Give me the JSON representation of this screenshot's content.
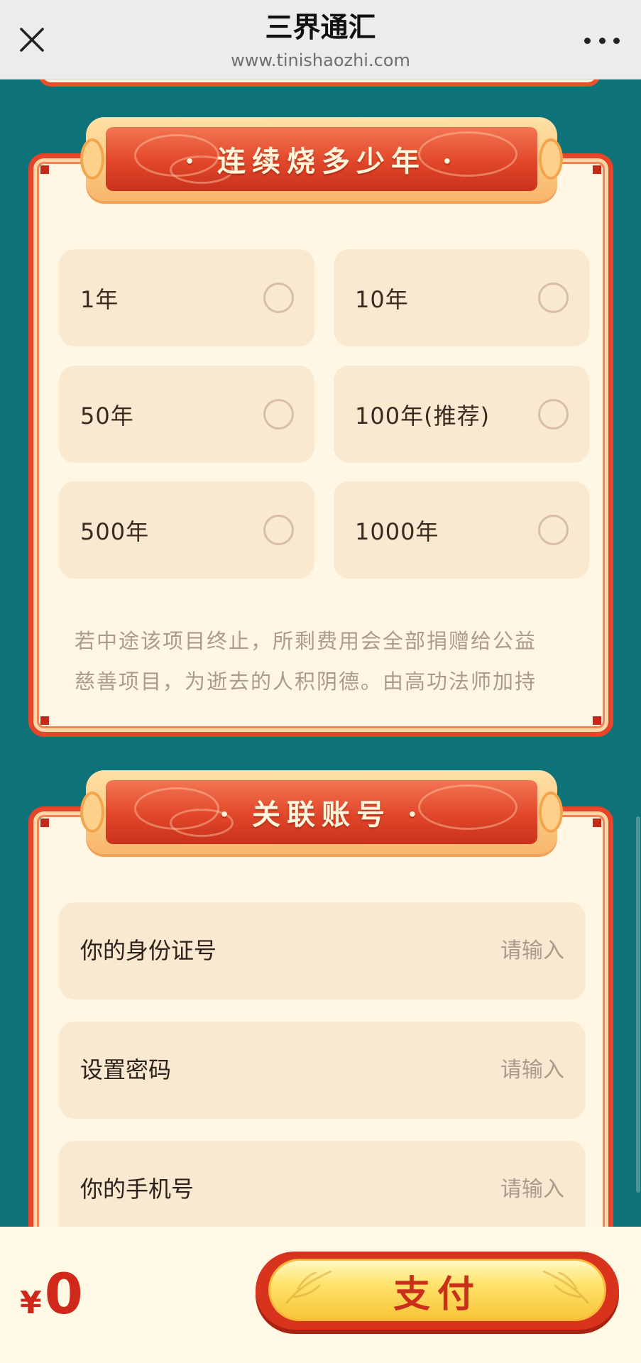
{
  "topbar": {
    "title": "三界通汇",
    "url": "www.tinishaozhi.com",
    "close_icon": "close-icon",
    "more_icon": "more-icon"
  },
  "duration_section": {
    "header": "· 连续烧多少年 ·",
    "options": [
      {
        "label": "1年",
        "selected": false
      },
      {
        "label": "10年",
        "selected": false
      },
      {
        "label": "50年",
        "selected": false
      },
      {
        "label": "100年(推荐)",
        "selected": false
      },
      {
        "label": "500年",
        "selected": false
      },
      {
        "label": "1000年",
        "selected": false
      }
    ],
    "note_lines": [
      "若中途该项目终止，所剩费用会全部捐赠给公益",
      "慈善项目，为逝去的人积阴德。由高功法师加持"
    ]
  },
  "account_section": {
    "header": "· 关联账号 ·",
    "fields": [
      {
        "label": "你的身份证号",
        "placeholder": "请输入",
        "value": ""
      },
      {
        "label": "设置密码",
        "placeholder": "请输入",
        "value": ""
      },
      {
        "label": "你的手机号",
        "placeholder": "请输入",
        "value": ""
      }
    ]
  },
  "paybar": {
    "currency": "¥",
    "amount": "0",
    "pay_label": "支付"
  },
  "colors": {
    "background": "#0e7379",
    "card_border": "#e6452a",
    "card_bg": "#fff7e4",
    "option_bg": "#f8e9d0",
    "price_red": "#d0281a",
    "pay_gold": "#ffe36a"
  }
}
